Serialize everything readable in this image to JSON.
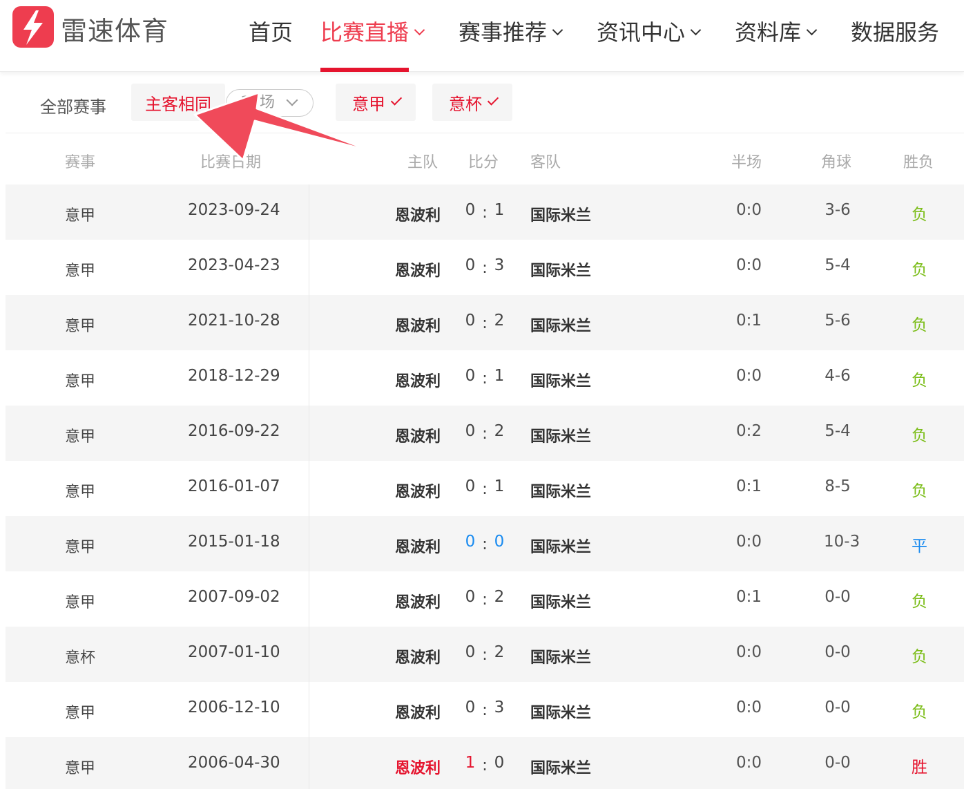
{
  "logo": {
    "text": "雷速体育"
  },
  "nav": {
    "items": [
      {
        "label": "首页",
        "dropdown": false,
        "active": false
      },
      {
        "label": "比赛直播",
        "dropdown": true,
        "active": true
      },
      {
        "label": "赛事推荐",
        "dropdown": true,
        "active": false
      },
      {
        "label": "资讯中心",
        "dropdown": true,
        "active": false
      },
      {
        "label": "资料库",
        "dropdown": true,
        "active": false
      },
      {
        "label": "数据服务",
        "dropdown": false,
        "active": false
      }
    ]
  },
  "filter": {
    "all_label": "全部赛事",
    "same_home_away": "主客相同",
    "count_select": "15场",
    "league_tags": [
      "意甲",
      "意杯"
    ]
  },
  "table": {
    "headers": {
      "league": "赛事",
      "date": "比赛日期",
      "home": "主队",
      "score": "比分",
      "away": "客队",
      "half": "半场",
      "corner": "角球",
      "result": "胜负"
    },
    "rows": [
      {
        "league": "意甲",
        "date": "2023-09-24",
        "home": "恩波利",
        "home_goals": "0",
        "away_goals": "1",
        "away": "国际米兰",
        "half": "0:0",
        "corner": "3-6",
        "result": "负",
        "outcome": "lose"
      },
      {
        "league": "意甲",
        "date": "2023-04-23",
        "home": "恩波利",
        "home_goals": "0",
        "away_goals": "3",
        "away": "国际米兰",
        "half": "0:0",
        "corner": "5-4",
        "result": "负",
        "outcome": "lose"
      },
      {
        "league": "意甲",
        "date": "2021-10-28",
        "home": "恩波利",
        "home_goals": "0",
        "away_goals": "2",
        "away": "国际米兰",
        "half": "0:1",
        "corner": "5-6",
        "result": "负",
        "outcome": "lose"
      },
      {
        "league": "意甲",
        "date": "2018-12-29",
        "home": "恩波利",
        "home_goals": "0",
        "away_goals": "1",
        "away": "国际米兰",
        "half": "0:0",
        "corner": "4-6",
        "result": "负",
        "outcome": "lose"
      },
      {
        "league": "意甲",
        "date": "2016-09-22",
        "home": "恩波利",
        "home_goals": "0",
        "away_goals": "2",
        "away": "国际米兰",
        "half": "0:2",
        "corner": "5-4",
        "result": "负",
        "outcome": "lose"
      },
      {
        "league": "意甲",
        "date": "2016-01-07",
        "home": "恩波利",
        "home_goals": "0",
        "away_goals": "1",
        "away": "国际米兰",
        "half": "0:1",
        "corner": "8-5",
        "result": "负",
        "outcome": "lose"
      },
      {
        "league": "意甲",
        "date": "2015-01-18",
        "home": "恩波利",
        "home_goals": "0",
        "away_goals": "0",
        "away": "国际米兰",
        "half": "0:0",
        "corner": "10-3",
        "result": "平",
        "outcome": "draw"
      },
      {
        "league": "意甲",
        "date": "2007-09-02",
        "home": "恩波利",
        "home_goals": "0",
        "away_goals": "2",
        "away": "国际米兰",
        "half": "0:1",
        "corner": "0-0",
        "result": "负",
        "outcome": "lose"
      },
      {
        "league": "意杯",
        "date": "2007-01-10",
        "home": "恩波利",
        "home_goals": "0",
        "away_goals": "2",
        "away": "国际米兰",
        "half": "0:0",
        "corner": "0-0",
        "result": "负",
        "outcome": "lose"
      },
      {
        "league": "意甲",
        "date": "2006-12-10",
        "home": "恩波利",
        "home_goals": "0",
        "away_goals": "3",
        "away": "国际米兰",
        "half": "0:0",
        "corner": "0-0",
        "result": "负",
        "outcome": "lose"
      },
      {
        "league": "意甲",
        "date": "2006-04-30",
        "home": "恩波利",
        "home_goals": "1",
        "away_goals": "0",
        "away": "国际米兰",
        "half": "0:0",
        "corner": "0-0",
        "result": "胜",
        "outcome": "win"
      }
    ]
  },
  "colors": {
    "brand": "#ee3d4f",
    "accent_red": "#e5142e",
    "lose_green": "#7bbd18",
    "draw_blue": "#1a8bf0"
  },
  "icons": {
    "logo": "lightning-bolt-icon",
    "dropdown": "chevron-down-icon",
    "check": "check-icon",
    "annotation": "pointer-arrow-icon"
  }
}
